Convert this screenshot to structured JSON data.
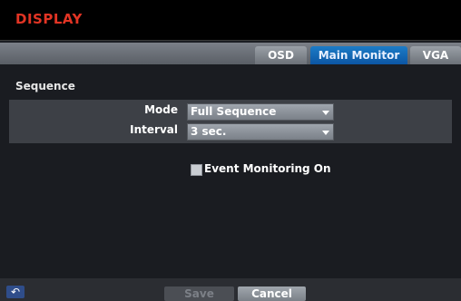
{
  "window": {
    "title": "DISPLAY"
  },
  "tabs": [
    "OSD",
    "Main Monitor",
    "VGA"
  ],
  "active_tab": "Main Monitor",
  "section": {
    "title": "Sequence"
  },
  "fields": {
    "mode_label": "Mode",
    "mode_value": "Full Sequence",
    "interval_label": "Interval",
    "interval_value": "3 sec."
  },
  "event_monitoring": {
    "label": "Event Monitoring On",
    "checked": false
  },
  "footer": {
    "back_icon": "back-arrow-icon",
    "save_label": "Save",
    "cancel_label": "Cancel"
  },
  "colors": {
    "title": "#e23424",
    "active_tab": "#0c55a3"
  }
}
